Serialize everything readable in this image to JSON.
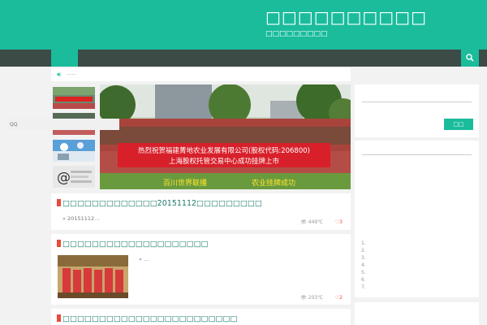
{
  "header": {
    "site_title": "□□□□□□□□□□",
    "site_description": "□□□□□□□□□"
  },
  "search": {
    "icon": "search-icon"
  },
  "notice": {
    "icon": "speaker-icon",
    "text": "……"
  },
  "slider": {
    "banner_text_1": "热烈祝贺福建菁地农业发展有限公司(股权代码:206800)",
    "banner_text_2": "上海股权托管交易中心成功挂牌上市",
    "caption_left": "百川世界联播",
    "caption_right": "农业挂牌成功"
  },
  "posts": [
    {
      "title": "□□□□□□□□□□□□□20151112□□□□□□□□□",
      "excerpt": "» 20151112…",
      "views": "449℃",
      "likes": "3"
    },
    {
      "title": "□□□□□□□□□□□□□□□□□□□□",
      "excerpt": "» …",
      "views": "203℃",
      "likes": "2"
    },
    {
      "title": "□□□□□□□□□□□□□□□□□□□□□□□□"
    }
  ],
  "sidebar": {
    "qq_placeholder": "QQ",
    "qq_button": "□□",
    "list": [
      "1.",
      "2.",
      "3.",
      "4.",
      "5.",
      "6.",
      "7."
    ]
  },
  "colors": {
    "accent": "#1abc9c",
    "nav": "#3d4b47",
    "background": "#f2f2f2",
    "mark": "#e74c3c"
  }
}
